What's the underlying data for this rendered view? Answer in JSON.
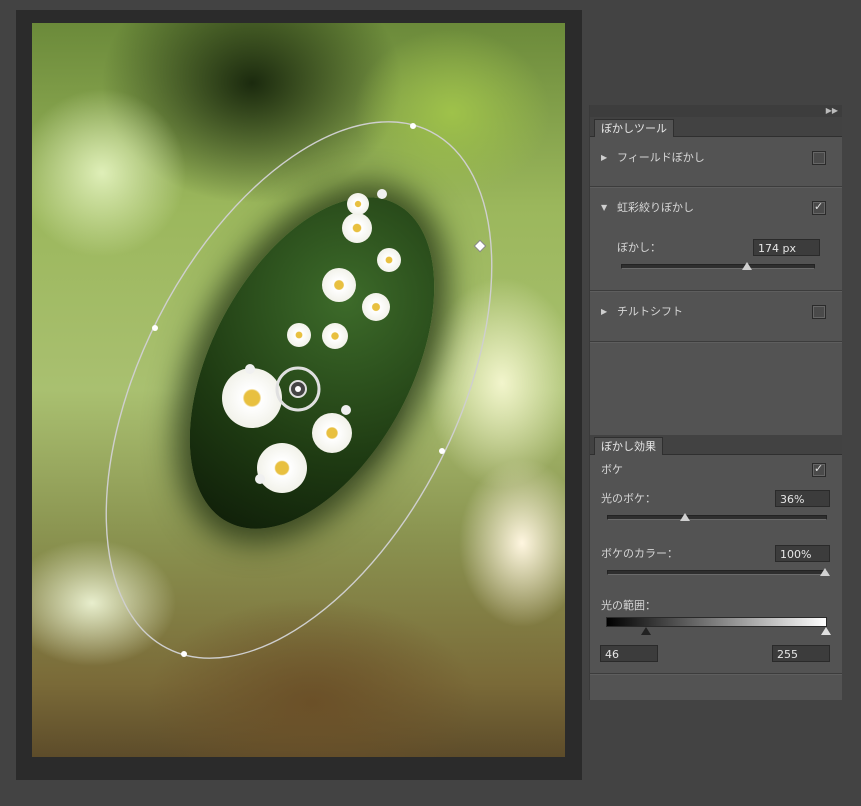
{
  "panel": {
    "collapse_icon": "double-chevron-right-icon",
    "blur_tools_tab": "ぼかしツール",
    "field_blur_label": "フィールドぼかし",
    "field_blur_checked": false,
    "iris_blur_label": "虹彩絞りぼかし",
    "iris_blur_checked": true,
    "blur_amount_label": "ぼかし：",
    "blur_amount_value": "174 px",
    "blur_amount_fraction": 0.69,
    "tilt_shift_label": "チルトシフト",
    "tilt_shift_checked": false
  },
  "effects": {
    "tab_label": "ぼかし効果",
    "bokeh_label": "ボケ",
    "bokeh_checked": true,
    "light_bokeh_label": "光のボケ：",
    "light_bokeh_value": "36%",
    "light_bokeh_fraction": 0.36,
    "bokeh_color_label": "ボケのカラー：",
    "bokeh_color_value": "100%",
    "bokeh_color_fraction": 1.0,
    "light_range_label": "光の範囲：",
    "light_range_low": "46",
    "light_range_high": "255",
    "light_range_low_fraction": 0.18,
    "light_range_high_fraction": 1.0
  }
}
